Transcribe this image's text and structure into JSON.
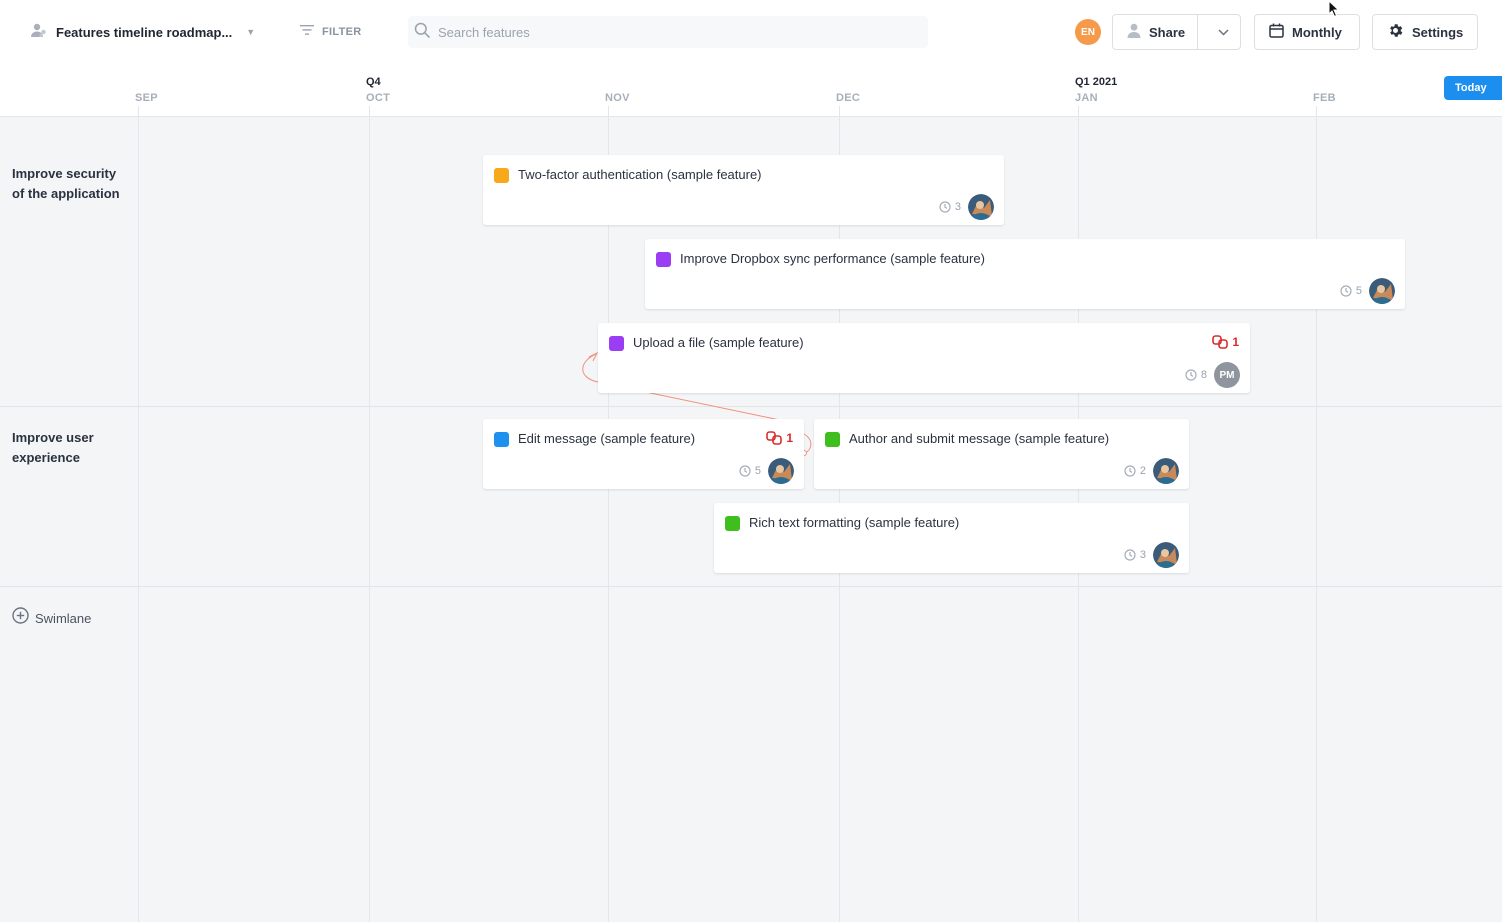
{
  "toolbar": {
    "roadmap_title": "Features timeline roadmap...",
    "filter_label": "FILTER",
    "search_placeholder": "Search features",
    "user_initials": "EN",
    "share_label": "Share",
    "view_label": "Monthly",
    "settings_label": "Settings"
  },
  "timeline": {
    "quarters": [
      {
        "label": "Q4"
      },
      {
        "label": "Q1 2021"
      }
    ],
    "months": [
      {
        "label": "SEP"
      },
      {
        "label": "OCT"
      },
      {
        "label": "NOV"
      },
      {
        "label": "DEC"
      },
      {
        "label": "JAN"
      },
      {
        "label": "FEB"
      }
    ],
    "today_label": "Today"
  },
  "swimlanes": [
    {
      "label_line1": "Improve security",
      "label_line2": "of the application"
    },
    {
      "label_line1": "Improve user",
      "label_line2": "experience"
    }
  ],
  "add_swimlane_label": "Swimlane",
  "features": [
    {
      "title": "Two-factor authentication (sample feature)",
      "color": "#f7a81b",
      "count": "3",
      "owner": "avatar"
    },
    {
      "title": "Improve Dropbox sync performance (sample feature)",
      "color": "#9b3df2",
      "count": "5",
      "owner": "avatar"
    },
    {
      "title": "Upload a file (sample feature)",
      "color": "#9b3df2",
      "count": "8",
      "owner": "PM",
      "dependencies": "1"
    },
    {
      "title": "Edit message (sample feature)",
      "color": "#1e90f0",
      "count": "5",
      "owner": "avatar",
      "dependencies": "1"
    },
    {
      "title": "Author and submit message (sample feature)",
      "color": "#3fbf1d",
      "count": "2",
      "owner": "avatar"
    },
    {
      "title": "Rich text formatting (sample feature)",
      "color": "#3fbf1d",
      "count": "3",
      "owner": "avatar"
    }
  ],
  "colors": {
    "accent": "#1b8ef0",
    "dependency": "#d92c2c",
    "user_avatar": "#f59a4a"
  },
  "icons": {
    "roadmap": "roadmap-people-icon",
    "filter": "filter-icon",
    "search": "search-icon",
    "share": "person-icon",
    "calendar": "calendar-icon",
    "settings": "gear-icon",
    "dependency": "link-icon",
    "clock": "clock-icon",
    "add": "plus-circle-icon"
  }
}
